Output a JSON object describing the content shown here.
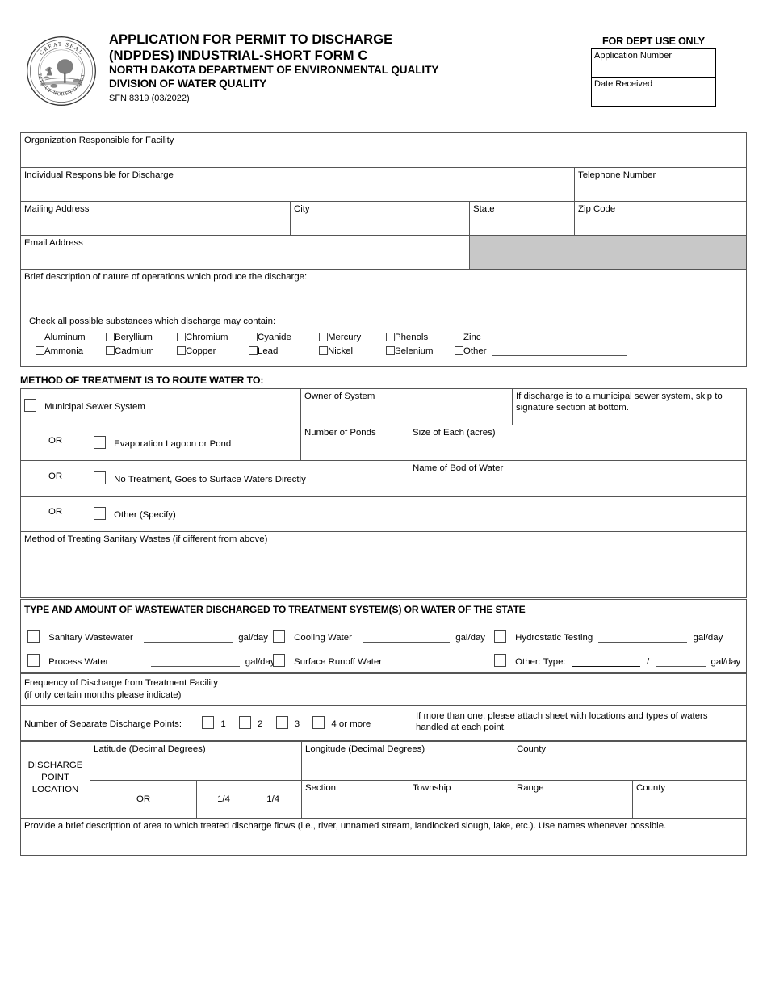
{
  "header": {
    "title_line1": "APPLICATION FOR PERMIT TO DISCHARGE",
    "title_line2": "(NDPDES) INDUSTRIAL-SHORT FORM C",
    "agency_line1": "NORTH DAKOTA DEPARTMENT OF ENVIRONMENTAL QUALITY",
    "agency_line2": "DIVISION OF WATER QUALITY",
    "form_number": "SFN 8319 (03/2022)",
    "seal_icon": "north-dakota-state-seal-icon",
    "dept_use": {
      "heading": "FOR DEPT USE ONLY",
      "application_number_label": "Application Number",
      "application_number_value": "",
      "date_received_label": "Date Received",
      "date_received_value": ""
    }
  },
  "facility": {
    "organization_label": "Organization Responsible for Facility",
    "organization_value": "",
    "individual_label": "Individual Responsible for Discharge",
    "individual_value": "",
    "telephone_label": "Telephone Number",
    "telephone_value": "",
    "mailing_address_label": "Mailing Address",
    "mailing_address_value": "",
    "city_label": "City",
    "city_value": "",
    "state_label": "State",
    "state_value": "",
    "zip_label": "Zip Code",
    "zip_value": "",
    "email_label": "Email Address",
    "email_value": "",
    "description_label": "Brief description of nature of operations which produce the discharge:",
    "description_value": ""
  },
  "substances": {
    "prompt": "Check all possible substances which discharge may contain:",
    "columns": [
      {
        "top": "Aluminum",
        "bottom": "Ammonia"
      },
      {
        "top": "Beryllium",
        "bottom": "Cadmium"
      },
      {
        "top": "Chromium",
        "bottom": "Copper"
      },
      {
        "top": "Cyanide",
        "bottom": "Lead"
      },
      {
        "top": "Mercury",
        "bottom": "Nickel"
      },
      {
        "top": "Phenols",
        "bottom": "Selenium"
      },
      {
        "top": "Zinc",
        "bottom": "Other"
      }
    ],
    "other_value": ""
  },
  "treatment": {
    "section_title": "METHOD OF TREATMENT IS TO ROUTE WATER TO:",
    "municipal_label": "Municipal Sewer System",
    "owner_label": "Owner of System",
    "owner_value": "",
    "note": "If discharge is to a municipal sewer system, skip to signature section at bottom.",
    "or_label": "OR",
    "lagoon_label": "Evaporation Lagoon or Pond",
    "number_of_ponds_label": "Number of Ponds",
    "number_of_ponds_value": "",
    "size_of_each_label": "Size of Each (acres)",
    "size_of_each_value": "",
    "no_treatment_label": "No Treatment, Goes to Surface Waters Directly",
    "body_of_water_label": "Name of Bod of Water",
    "body_of_water_value": "",
    "other_label": "Other (Specify)",
    "other_value": "",
    "sanitary_method_label": "Method of Treating Sanitary Wastes (if different from above)",
    "sanitary_method_value": ""
  },
  "wastewater": {
    "section_title": "TYPE AND AMOUNT OF WASTEWATER DISCHARGED TO TREATMENT SYSTEM(S) OR WATER OF THE STATE",
    "unit_label": "gal/day",
    "sanitary_label": "Sanitary Wastewater",
    "sanitary_value": "",
    "cooling_label": "Cooling Water",
    "cooling_value": "",
    "hydrostatic_label": "Hydrostatic Testing",
    "hydrostatic_value": "",
    "process_label": "Process Water",
    "process_value": "",
    "surface_runoff_label": "Surface Runoff Water",
    "other_label": "Other: Type:",
    "other_type_value": "",
    "other_slash": "/",
    "other_amount_value": ""
  },
  "frequency": {
    "line1": "Frequency of Discharge from Treatment Facility",
    "line2": "(if only certain months please indicate)",
    "value": ""
  },
  "discharge_points": {
    "prompt": "Number of Separate Discharge Points:",
    "options": [
      "1",
      "2",
      "3",
      "4 or more"
    ],
    "note": "If more than one, please attach sheet with locations and types of waters handled at each point."
  },
  "location": {
    "row_label_line1": "DISCHARGE",
    "row_label_line2": "POINT",
    "row_label_line3": "LOCATION",
    "latitude_label": "Latitude (Decimal Degrees)",
    "latitude_value": "",
    "longitude_label": "Longitude (Decimal Degrees)",
    "longitude_value": "",
    "county_label": "County",
    "county_value": "",
    "or_label": "OR",
    "quarter_label_1": "1/4",
    "quarter_label_2": "1/4",
    "section_label": "Section",
    "section_value": "",
    "township_label": "Township",
    "township_value": "",
    "range_label": "Range",
    "range_value": "",
    "county2_label": "County",
    "county2_value": "",
    "description_label": "Provide a brief description of area to which treated discharge flows (i.e., river, unnamed stream, landlocked slough, lake, etc.).  Use names whenever possible.",
    "description_value": ""
  }
}
